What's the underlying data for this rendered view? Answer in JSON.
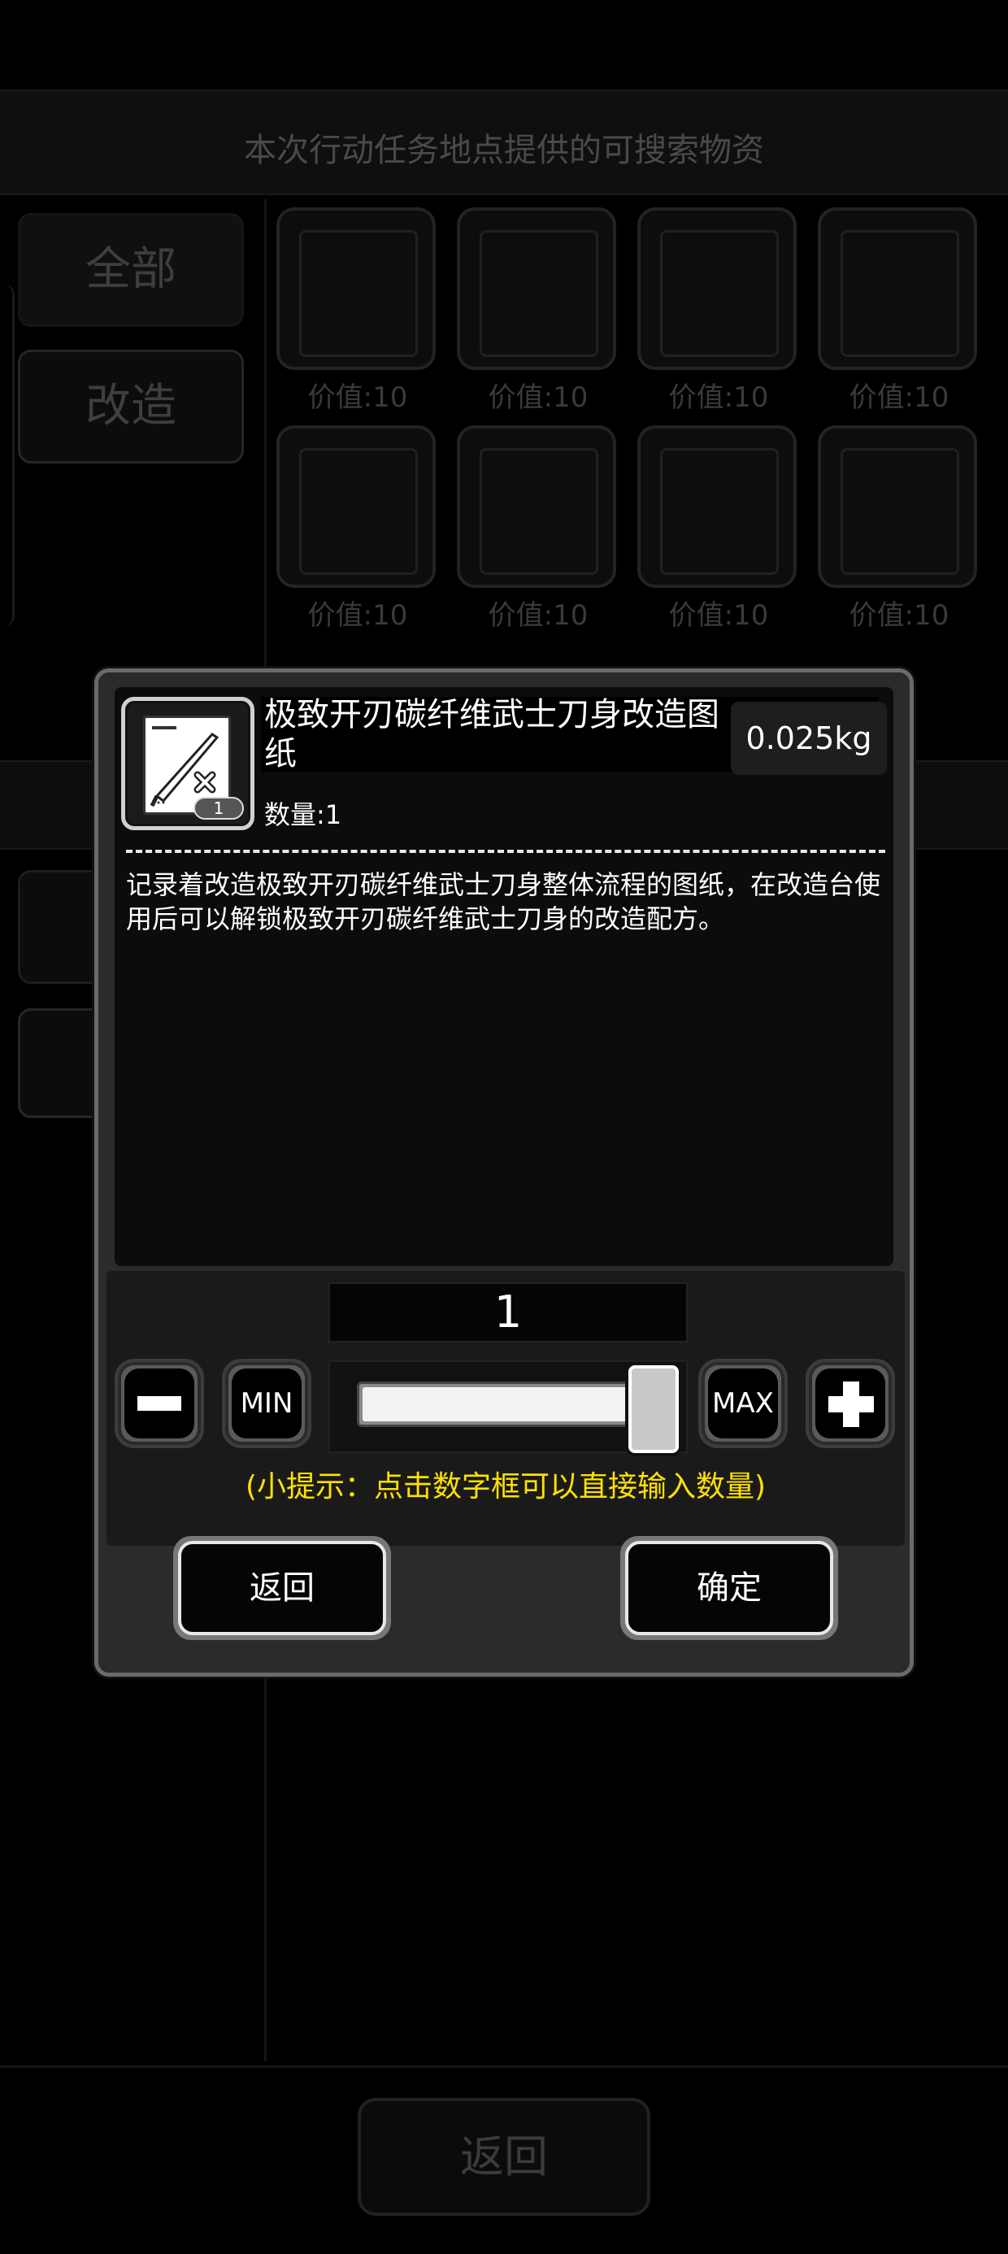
{
  "background": {
    "header_title": "本次行动任务地点提供的可搜索物资",
    "sidebar_tabs": [
      "全部",
      "改造"
    ],
    "grid_values": [
      "价值:10",
      "价值:10",
      "价值:10",
      "价值:10",
      "价值:10",
      "价值:10",
      "价值:10",
      "价值:10"
    ],
    "footer_back_label": "返回"
  },
  "dialog": {
    "item_name": "极致开刃碳纤维武士刀身改造图纸",
    "weight": "0.025kg",
    "quantity_label": "数量:1",
    "icon_count": "1",
    "icon": "blueprint-sword-wrench-icon",
    "description": "记录着改造极致开刃碳纤维武士刀身整体流程的图纸，在改造台使用后可以解锁极致开刃碳纤维武士刀身的改造配方。",
    "selected_quantity": "1",
    "slider_fraction": 1.0,
    "min_label": "MIN",
    "max_label": "MAX",
    "tip": "(小提示：点击数字框可以直接输入数量)",
    "back_label": "返回",
    "confirm_label": "确定",
    "tip_color": "#ffe100"
  }
}
